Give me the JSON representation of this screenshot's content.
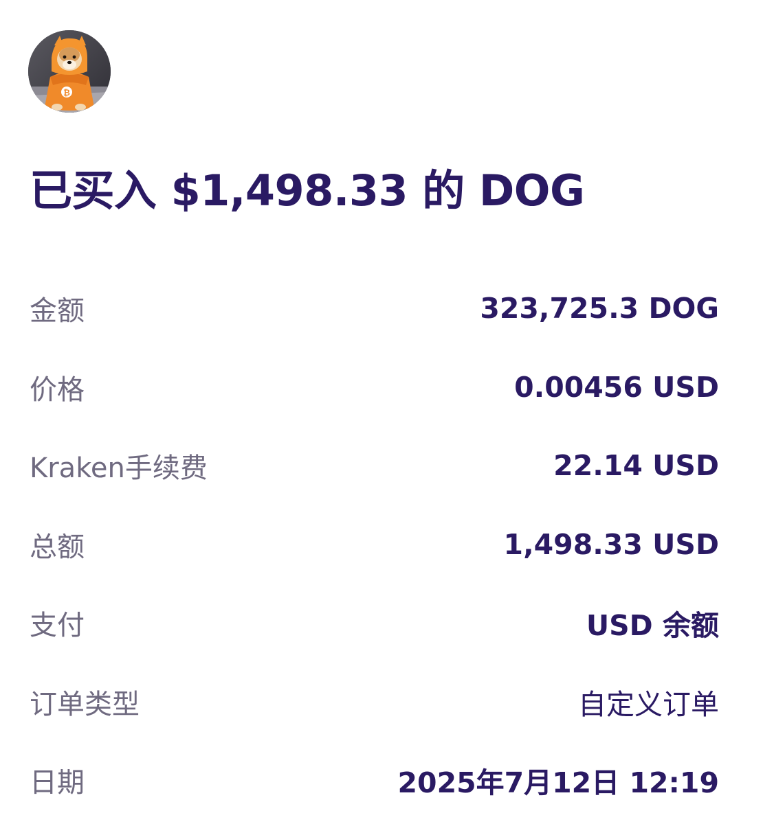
{
  "header": {
    "avatar_icon": "dog-in-orange-bitcoin-hoodie",
    "title": "已买入 $1,498.33 的 DOG"
  },
  "details": {
    "rows": [
      {
        "label": "金额",
        "value": "323,725.3 DOG"
      },
      {
        "label": "价格",
        "value": "0.00456 USD"
      },
      {
        "label": "Kraken手续费",
        "value": "22.14 USD"
      },
      {
        "label": "总额",
        "value": "1,498.33 USD"
      },
      {
        "label": "支付",
        "value": "USD 余额"
      },
      {
        "label": "订单类型",
        "value": "自定义订单"
      },
      {
        "label": "日期",
        "value": "2025年7月12日 12:19"
      }
    ]
  },
  "colors": {
    "primary_text": "#2a1a63",
    "secondary_text": "#6f6a80",
    "background": "#ffffff"
  }
}
